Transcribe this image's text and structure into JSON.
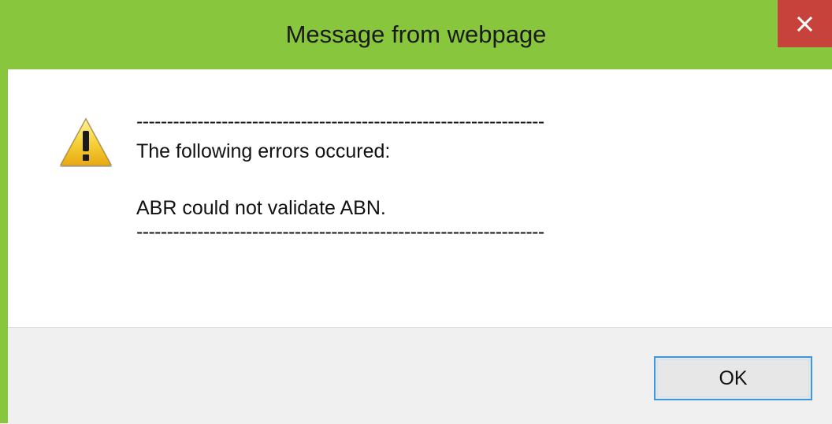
{
  "dialog": {
    "title": "Message from webpage",
    "close_icon": "close-icon",
    "icon": "warning-icon",
    "message": {
      "separator_top": "-------------------------------------------------------------------",
      "line1": "The following errors occured:",
      "line2": "ABR could not validate ABN.",
      "separator_bottom": "-------------------------------------------------------------------"
    },
    "ok_label": "OK"
  },
  "colors": {
    "frame": "#88c63e",
    "close_button": "#c7423a",
    "footer": "#f0f0f0",
    "button_focus_border": "#3c96e0"
  }
}
